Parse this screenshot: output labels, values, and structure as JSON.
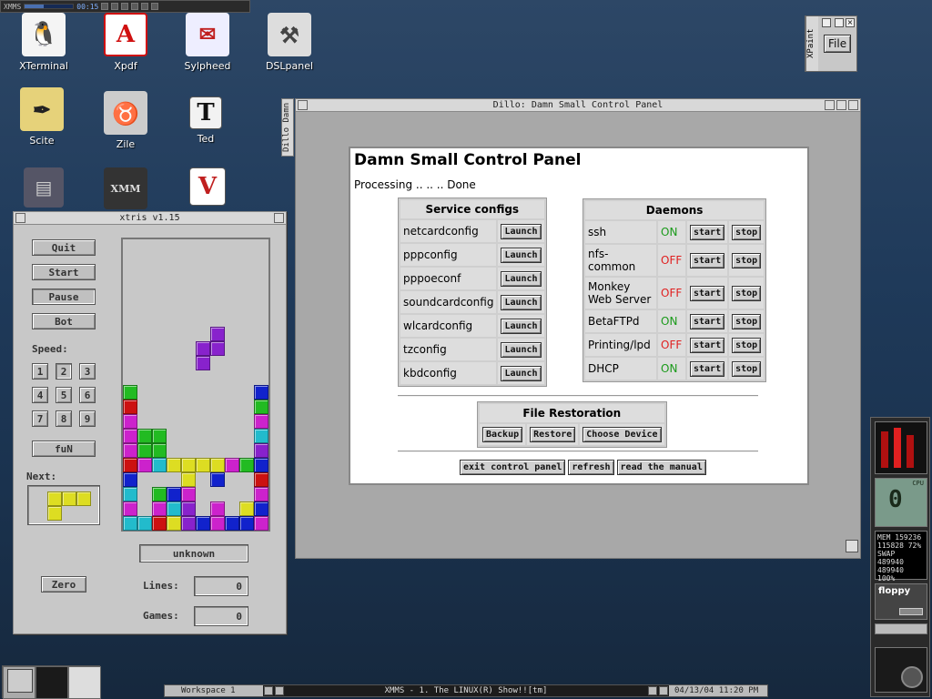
{
  "xmms_bar": {
    "title": "XMMS",
    "time": "00:15"
  },
  "desktop_icons": [
    {
      "label": "XTerminal",
      "icon": "penguin-icon"
    },
    {
      "label": "Xpdf",
      "icon": "pdf-icon"
    },
    {
      "label": "Sylpheed",
      "icon": "mail-icon"
    },
    {
      "label": "DSLpanel",
      "icon": "tools-icon"
    },
    {
      "label": "Scite",
      "icon": "pen-icon"
    },
    {
      "label": "Zile",
      "icon": "gnu-icon"
    },
    {
      "label": "Ted",
      "icon": "text-editor-icon"
    },
    {
      "label": "",
      "icon": "cabinet-icon"
    },
    {
      "label": "",
      "icon": "xmm-system-icon"
    },
    {
      "label": "",
      "icon": "vnc-icon"
    }
  ],
  "xpaint": {
    "title": "XPaint",
    "file_button": "File"
  },
  "xtris": {
    "title": "xtris v1.15",
    "buttons": {
      "quit": "Quit",
      "start": "Start",
      "pause": "Pause",
      "bot": "Bot",
      "fun": "fuN",
      "zero": "Zero"
    },
    "speed_label": "Speed:",
    "speeds": [
      "1",
      "2",
      "3",
      "4",
      "5",
      "6",
      "7",
      "8",
      "9"
    ],
    "selected_speed": "2",
    "next_label": "Next:",
    "player_name": "unknown",
    "lines_label": "Lines:",
    "lines_value": "0",
    "games_label": "Games:",
    "games_value": "0"
  },
  "dillo": {
    "window_title": "Dillo: Damn Small Control Panel",
    "side_tab": "Dillo Damn",
    "page": {
      "heading": "Damn Small Control Panel",
      "processing": "Processing .. .. .. Done",
      "service_configs": {
        "header": "Service configs",
        "button_label": "Launch",
        "items": [
          "netcardconfig",
          "pppconfig",
          "pppoeconf",
          "soundcardconfig",
          "wlcardconfig",
          "tzconfig",
          "kbdconfig"
        ]
      },
      "daemons": {
        "header": "Daemons",
        "start_label": "start",
        "stop_label": "stop",
        "items": [
          {
            "name": "ssh",
            "status": "ON"
          },
          {
            "name": "nfs-common",
            "status": "OFF"
          },
          {
            "name": "Monkey Web Server",
            "status": "OFF"
          },
          {
            "name": "BetaFTPd",
            "status": "ON"
          },
          {
            "name": "Printing/lpd",
            "status": "OFF"
          },
          {
            "name": "DHCP",
            "status": "ON"
          }
        ]
      },
      "file_restoration": {
        "header": "File Restoration",
        "backup": "Backup",
        "restore": "Restore",
        "choose_device": "Choose Device"
      },
      "bottom_buttons": {
        "exit": "exit control panel",
        "refresh": "refresh",
        "manual": "read the manual"
      }
    }
  },
  "taskbar": {
    "workspace": "Workspace 1",
    "task": "XMMS - 1. The LINUX(R) Show!![tm]",
    "clock": "04/13/04 11:20 PM"
  },
  "dock": {
    "cpu_label": "CPU",
    "cpu_percent": "0",
    "mem_label": "MEM",
    "mem_value": "159236",
    "mem_line2": "115828 72%",
    "swap_label": "SWAP",
    "swap_value": "489940",
    "swap_line2": "489940 100%",
    "floppy_label": "floppy"
  },
  "colors": {
    "on": "#1a9a1a",
    "off": "#e02020",
    "tetris_green": "#22bb22",
    "tetris_red": "#cc1111",
    "tetris_magenta": "#cc22cc",
    "tetris_blue": "#1122cc",
    "tetris_cyan": "#22bbcc",
    "tetris_yellow": "#dddd22",
    "tetris_purple": "#8822cc"
  }
}
